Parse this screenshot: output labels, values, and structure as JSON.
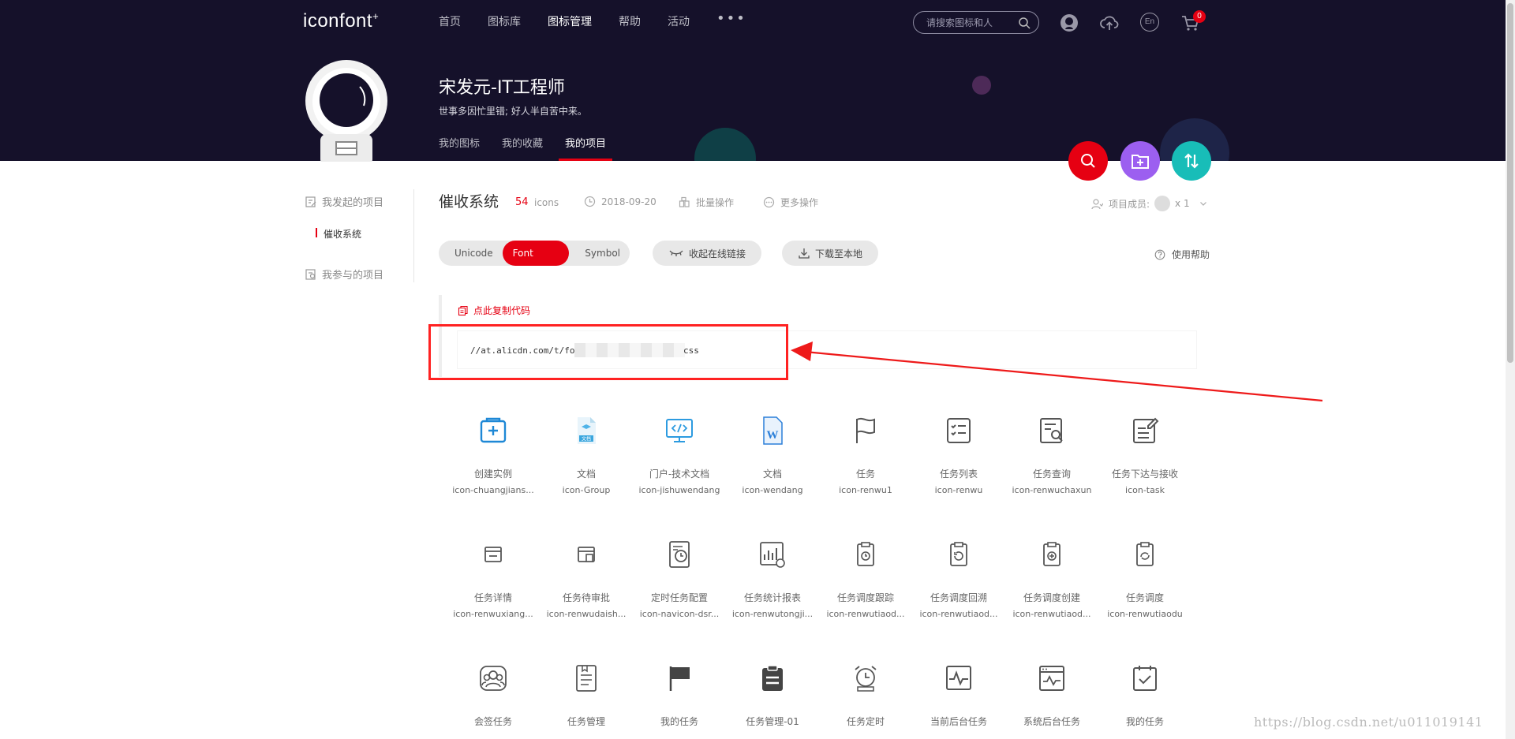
{
  "header": {
    "logo": "iconfont",
    "logo_mark": "+",
    "nav": [
      "首页",
      "图标库",
      "图标管理",
      "帮助",
      "活动"
    ],
    "nav_active": "图标管理",
    "more": "•••",
    "search_placeholder": "请搜索图标和人",
    "cart_count": "0",
    "lang_label": "En"
  },
  "profile": {
    "name": "宋发元-IT工程师",
    "motto": "世事多因忙里错; 好人半自苦中来。",
    "tabs": [
      "我的图标",
      "我的收藏",
      "我的项目"
    ],
    "active_tab": "我的项目"
  },
  "sidebar": {
    "started": "我发起的项目",
    "active_project": "催收系统",
    "joined": "我参与的项目"
  },
  "project": {
    "name": "催收系统",
    "count": "54",
    "unit": "icons",
    "date": "2018-09-20",
    "batch": "批量操作",
    "more_ops": "更多操作",
    "members_label": "项目成员:",
    "members_count": "x 1",
    "formats": [
      "Unicode",
      "Font class",
      "Symbol"
    ],
    "active_format": "Font class",
    "collapse_link": "收起在线链接",
    "download": "下载至本地",
    "help": "使用帮助",
    "copy_code": "点此复制代码",
    "code_prefix": "//at.alicdn.com/t/fo",
    "code_suffix": "css"
  },
  "icons": [
    {
      "cn": "创建实例",
      "en": "icon-chuangjians...",
      "icon": "create-instance-icon",
      "color": "#1e88d6"
    },
    {
      "cn": "文档",
      "en": "icon-Group",
      "icon": "document-colored-icon",
      "color": "#4fb3e8"
    },
    {
      "cn": "门户-技术文档",
      "en": "icon-jishuwendang",
      "icon": "code-monitor-icon",
      "color": "#2d9be0"
    },
    {
      "cn": "文档",
      "en": "icon-wendang",
      "icon": "word-icon",
      "color": "#2b7fd9"
    },
    {
      "cn": "任务",
      "en": "icon-renwu1",
      "icon": "flag-icon",
      "color": "#555"
    },
    {
      "cn": "任务列表",
      "en": "icon-renwu",
      "icon": "task-list-icon",
      "color": "#555"
    },
    {
      "cn": "任务查询",
      "en": "icon-renwuchaxun",
      "icon": "task-search-icon",
      "color": "#555"
    },
    {
      "cn": "任务下达与接收",
      "en": "icon-task",
      "icon": "task-edit-icon",
      "color": "#555"
    },
    {
      "cn": "任务详情",
      "en": "icon-renwuxiang...",
      "icon": "task-detail-icon",
      "color": "#555"
    },
    {
      "cn": "任务待审批",
      "en": "icon-renwudaish...",
      "icon": "task-approve-icon",
      "color": "#555"
    },
    {
      "cn": "定时任务配置",
      "en": "icon-navicon-dsr...",
      "icon": "timer-doc-icon",
      "color": "#555"
    },
    {
      "cn": "任务统计报表",
      "en": "icon-renwutongji...",
      "icon": "report-icon",
      "color": "#555"
    },
    {
      "cn": "任务调度跟踪",
      "en": "icon-renwutiaod...",
      "icon": "schedule-track-icon",
      "color": "#555"
    },
    {
      "cn": "任务调度回溯",
      "en": "icon-renwutiaod...",
      "icon": "schedule-back-icon",
      "color": "#555"
    },
    {
      "cn": "任务调度创建",
      "en": "icon-renwutiaod...",
      "icon": "schedule-create-icon",
      "color": "#555"
    },
    {
      "cn": "任务调度",
      "en": "icon-renwutiaodu",
      "icon": "schedule-icon",
      "color": "#555"
    },
    {
      "cn": "会签任务",
      "en": "",
      "icon": "countersign-icon",
      "color": "#555"
    },
    {
      "cn": "任务管理",
      "en": "",
      "icon": "task-manage-icon",
      "color": "#555"
    },
    {
      "cn": "我的任务",
      "en": "",
      "icon": "my-task-flag-icon",
      "color": "#444"
    },
    {
      "cn": "任务管理-01",
      "en": "",
      "icon": "clipboard-icon",
      "color": "#444"
    },
    {
      "cn": "任务定时",
      "en": "",
      "icon": "alarm-clock-icon",
      "color": "#555"
    },
    {
      "cn": "当前后台任务",
      "en": "",
      "icon": "pulse-monitor-icon",
      "color": "#555"
    },
    {
      "cn": "系统后台任务",
      "en": "",
      "icon": "system-task-icon",
      "color": "#555"
    },
    {
      "cn": "我的任务",
      "en": "",
      "icon": "calendar-check-icon",
      "color": "#555"
    }
  ],
  "watermark": "https://blog.csdn.net/u011019141"
}
